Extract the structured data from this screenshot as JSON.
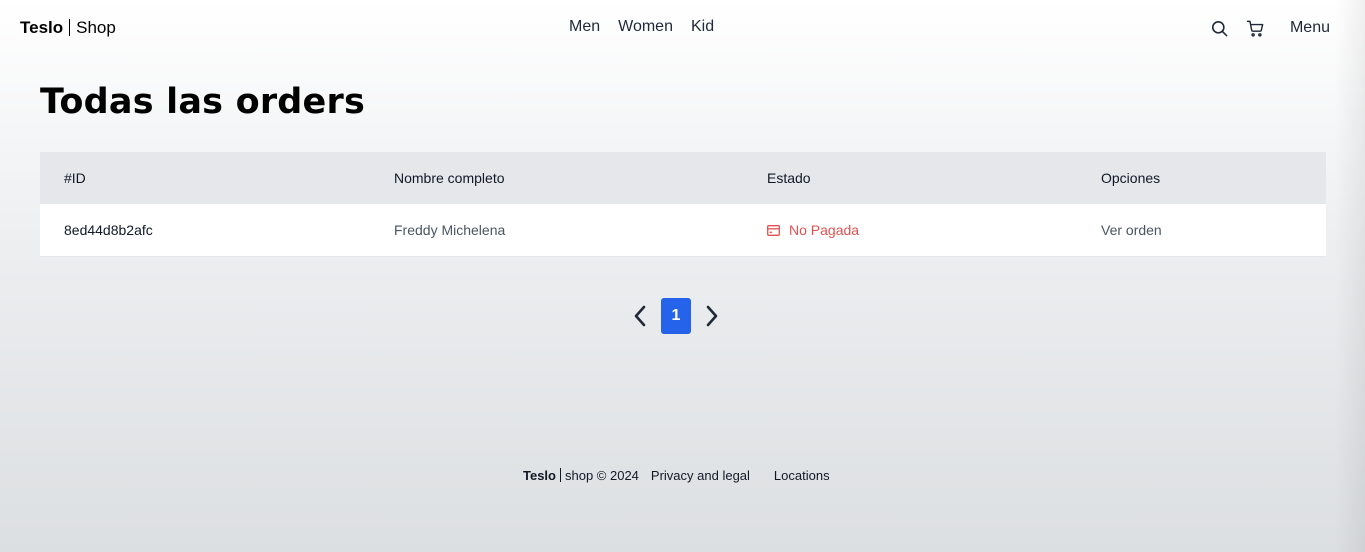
{
  "header": {
    "brand_bold": "Teslo",
    "brand_light": "Shop",
    "nav": [
      "Men",
      "Women",
      "Kid"
    ],
    "search_icon": "search-icon",
    "cart_icon": "cart-icon",
    "menu_label": "Menu"
  },
  "page": {
    "title": "Todas las orders"
  },
  "table": {
    "headers": [
      "#ID",
      "Nombre completo",
      "Estado",
      "Opciones"
    ],
    "rows": [
      {
        "id": "8ed44d8b2afc",
        "name": "Freddy Michelena",
        "status": "No Pagada",
        "status_icon": "credit-card-icon",
        "status_color": "#dc2626",
        "action": "Ver orden"
      }
    ]
  },
  "pagination": {
    "current": "1",
    "prev_icon": "chevron-left-icon",
    "next_icon": "chevron-right-icon",
    "active_color": "#2563eb"
  },
  "footer": {
    "brand_bold": "Teslo",
    "brand_rest": "shop © 2024",
    "links": [
      "Privacy and legal",
      "Locations"
    ]
  }
}
